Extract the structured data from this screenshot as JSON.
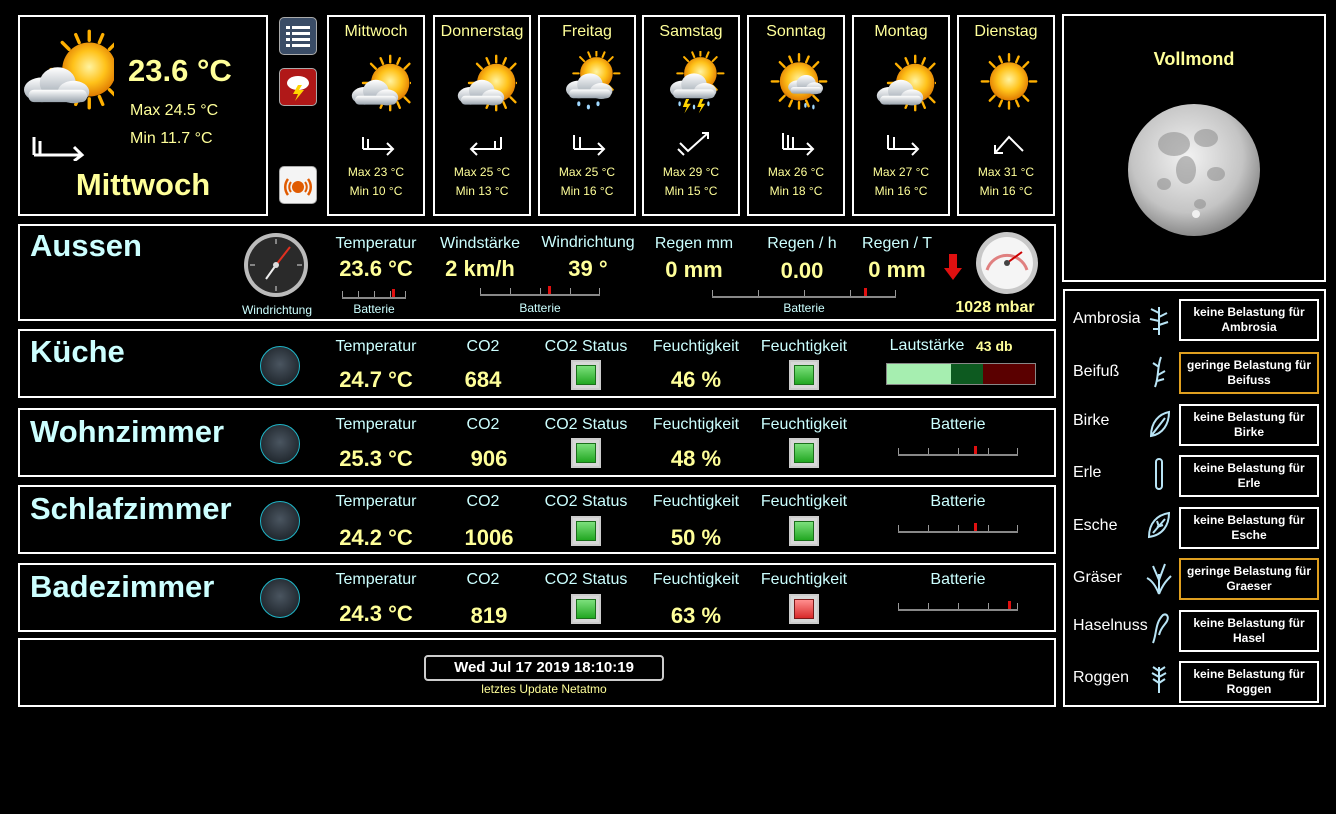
{
  "current": {
    "temperature": "23.6 °C",
    "max": "Max 24.5 °C",
    "min": "Min 11.7 °C",
    "day": "Mittwoch",
    "icon": "partly-cloudy-icon"
  },
  "buttons": [
    "list-icon",
    "storm-warning-icon",
    "alarm-icon"
  ],
  "forecast": [
    {
      "day": "Mittwoch",
      "max": "Max 23 °C",
      "min": "Min 10 °C",
      "icon": "partly-cloudy-icon"
    },
    {
      "day": "Donnerstag",
      "max": "Max 25 °C",
      "min": "Min 13 °C",
      "icon": "partly-cloudy-icon"
    },
    {
      "day": "Freitag",
      "max": "Max 25 °C",
      "min": "Min 16 °C",
      "icon": "rain-icon"
    },
    {
      "day": "Samstag",
      "max": "Max 29 °C",
      "min": "Min 15 °C",
      "icon": "thunderstorm-icon"
    },
    {
      "day": "Sonntag",
      "max": "Max 26 °C",
      "min": "Min 18 °C",
      "icon": "sun-rain-icon"
    },
    {
      "day": "Montag",
      "max": "Max 27 °C",
      "min": "Min 16 °C",
      "icon": "partly-cloudy-icon"
    },
    {
      "day": "Dienstag",
      "max": "Max 31 °C",
      "min": "Min 16 °C",
      "icon": "sun-icon"
    }
  ],
  "moon": {
    "phase": "Vollmond"
  },
  "aussen": {
    "title": "Aussen",
    "gauge_label": "Windrichtung",
    "labels": {
      "temp": "Temperatur",
      "wind": "Windstärke",
      "dir": "Windrichtung",
      "rain": "Regen mm",
      "rain_h": "Regen / h",
      "rain_t": "Regen / T"
    },
    "values": {
      "temp": "23.6 °C",
      "wind": "2 km/h",
      "dir": "39 °",
      "rain": "0 mm",
      "rain_h": "0.00",
      "rain_t": "0 mm"
    },
    "battery": "Batterie",
    "pressure": "1028 mbar"
  },
  "rooms": [
    {
      "title": "Küche",
      "labels": [
        "Temperatur",
        "CO2",
        "CO2 Status",
        "Feuchtigkeit",
        "Feuchtigkeit"
      ],
      "temp": "24.7 °C",
      "co2": "684",
      "humidity": "46 %",
      "co2_status": "green",
      "hum_status": "green",
      "extra_label": "Lautstärke",
      "extra_value": "43 db"
    },
    {
      "title": "Wohnzimmer",
      "labels": [
        "Temperatur",
        "CO2",
        "CO2 Status",
        "Feuchtigkeit",
        "Feuchtigkeit"
      ],
      "temp": "25.3 °C",
      "co2": "906",
      "humidity": "48 %",
      "co2_status": "green",
      "hum_status": "green",
      "extra_label": "Batterie"
    },
    {
      "title": "Schlafzimmer",
      "labels": [
        "Temperatur",
        "CO2",
        "CO2 Status",
        "Feuchtigkeit",
        "Feuchtigkeit"
      ],
      "temp": "24.2 °C",
      "co2": "1006",
      "humidity": "50 %",
      "co2_status": "green",
      "hum_status": "green",
      "extra_label": "Batterie"
    },
    {
      "title": "Badezimmer",
      "labels": [
        "Temperatur",
        "CO2",
        "CO2 Status",
        "Feuchtigkeit",
        "Feuchtigkeit"
      ],
      "temp": "24.3 °C",
      "co2": "819",
      "humidity": "63 %",
      "co2_status": "green",
      "hum_status": "red",
      "extra_label": "Batterie"
    }
  ],
  "update": {
    "timestamp": "Wed Jul 17 2019 18:10:19",
    "label": "letztes Update Netatmo"
  },
  "pollen": [
    {
      "name": "Ambrosia",
      "text": "keine Belastung für Ambrosia",
      "level": "none"
    },
    {
      "name": "Beifuß",
      "text": "geringe Belastung für Beifuss",
      "level": "low"
    },
    {
      "name": "Birke",
      "text": "keine Belastung für Birke",
      "level": "none"
    },
    {
      "name": "Erle",
      "text": "keine Belastung für Erle",
      "level": "none"
    },
    {
      "name": "Esche",
      "text": "keine Belastung für Esche",
      "level": "none"
    },
    {
      "name": "Gräser",
      "text": "geringe Belastung für Graeser",
      "level": "low"
    },
    {
      "name": "Haselnuss",
      "text": "keine Belastung für Hasel",
      "level": "none"
    },
    {
      "name": "Roggen",
      "text": "keine Belastung für Roggen",
      "level": "none"
    }
  ],
  "colors": {
    "accent_yellow": "#ffff99",
    "label_cyan": "#ccffff",
    "warn_border": "#e0a020"
  }
}
